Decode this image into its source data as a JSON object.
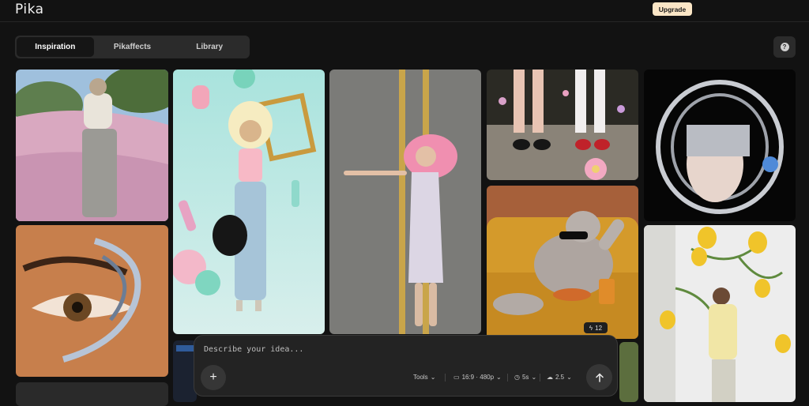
{
  "app": {
    "logo": "Pika",
    "upgrade_label": "Upgrade"
  },
  "tabs": [
    {
      "label": "Inspiration",
      "active": true
    },
    {
      "label": "Pikaffects",
      "active": false
    },
    {
      "label": "Library",
      "active": false
    }
  ],
  "help": {
    "icon": "question-icon",
    "glyph": "?"
  },
  "gallery": {
    "items": [
      {
        "name": "gallery-item-photographer-field"
      },
      {
        "name": "gallery-item-woman-floating-shapes"
      },
      {
        "name": "gallery-item-woman-road"
      },
      {
        "name": "gallery-item-legs-flowers"
      },
      {
        "name": "gallery-item-chrome-headpiece"
      },
      {
        "name": "gallery-item-chrome-eye"
      },
      {
        "name": "gallery-item-bunny-couch"
      },
      {
        "name": "gallery-item-tulips-mirror"
      }
    ],
    "badge_count": "12"
  },
  "prompt": {
    "placeholder": "Describe your idea...",
    "tools_label": "Tools",
    "aspect_label": "16:9 · 480p",
    "duration_label": "5s",
    "model_label": "2.5"
  },
  "colors": {
    "accent_upgrade": "#fbe6c6",
    "background": "#121212",
    "panel": "#232323"
  }
}
